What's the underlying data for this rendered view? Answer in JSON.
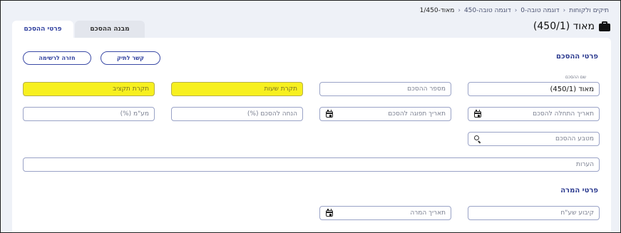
{
  "breadcrumb": {
    "items": [
      "תיקים ולקוחות",
      "דוגמה טובה-0",
      "דוגמה טובה-450"
    ],
    "current": "מאוד-1/450"
  },
  "page": {
    "title": "מאוד (450/1)",
    "icon": "briefcase-icon"
  },
  "tabs": [
    {
      "label": "פרטי ההסכם",
      "active": true
    },
    {
      "label": "מבנה ההסכם",
      "active": false
    }
  ],
  "section1": {
    "title": "פרטי ההסכם",
    "buttons": {
      "link_to_case": "קשר לתיק",
      "back_to_list": "חזרה לרשימה"
    },
    "agreement_name": {
      "label": "שם ההסכם",
      "value": "מאוד (450/1)"
    },
    "agreement_number": {
      "placeholder": "מספר ההסכם"
    },
    "hours_cap": {
      "placeholder": "תקרת שעות"
    },
    "budget_cap": {
      "placeholder": "תקרת תקציב"
    },
    "start_date": {
      "placeholder": "תאריך התחלה להסכם"
    },
    "end_date": {
      "placeholder": "תאריך תפוגה להסכם"
    },
    "discount": {
      "placeholder": "הנחה להסכם (%)"
    },
    "vat": {
      "placeholder": "מע\"מ (%)"
    },
    "currency": {
      "placeholder": "מטבע ההסכם"
    },
    "notes": {
      "placeholder": "הערות"
    }
  },
  "section2": {
    "title": "פרטי המרה",
    "rate_setting": {
      "placeholder": "קיבוע שע\"ח"
    },
    "conversion_date": {
      "placeholder": "תאריך המרה"
    }
  },
  "colors": {
    "accent": "#2f3f9e",
    "highlight": "#f7f01f",
    "background": "#eef1f7"
  }
}
